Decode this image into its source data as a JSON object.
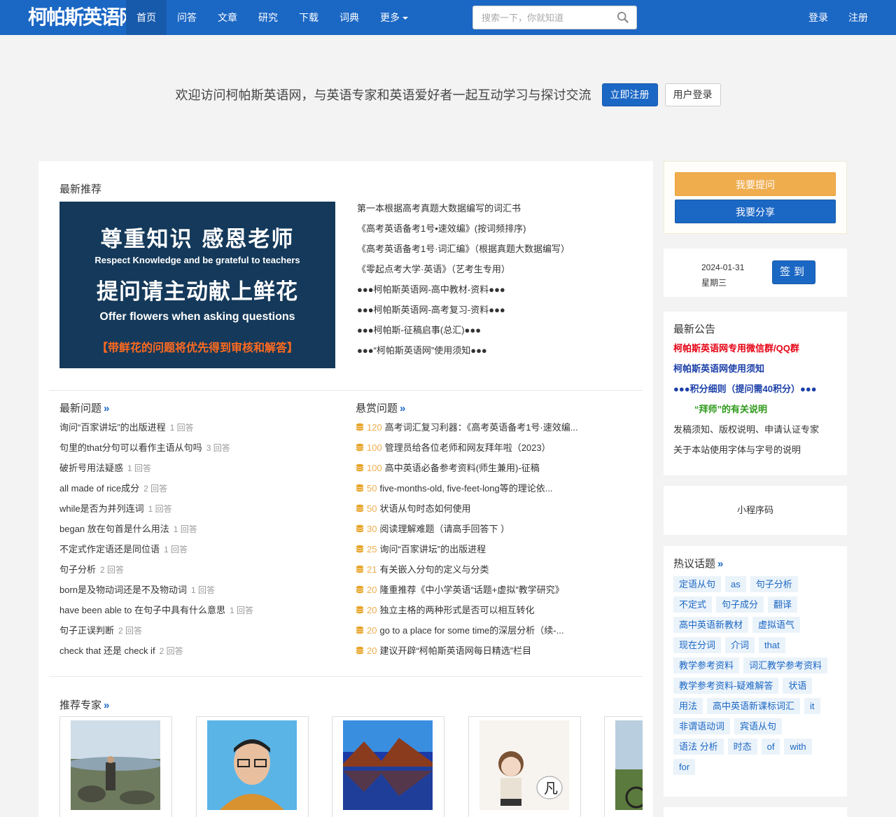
{
  "header": {
    "logo": "柯帕斯英语网",
    "nav": [
      "首页",
      "问答",
      "文章",
      "研究",
      "下载",
      "词典"
    ],
    "more": "更多",
    "search_placeholder": "搜索一下，你就知道",
    "login": "登录",
    "register": "注册"
  },
  "welcome": {
    "text": "欢迎访问柯帕斯英语网，与英语专家和英语爱好者一起互动学习与探讨交流",
    "register_btn": "立即注册",
    "login_btn": "用户登录"
  },
  "recommend": {
    "title": "最新推荐",
    "banner": {
      "line1": "尊重知识  感恩老师",
      "line2": "Respect Knowledge and be grateful to teachers",
      "line3": "提问请主动献上鲜花",
      "line4": "Offer flowers when asking questions",
      "line5": "【带鲜花的问题将优先得到审核和解答】"
    },
    "items": [
      "第一本根据高考真题大数据编写的词汇书",
      "《高考英语备考1号•速效编》(按词频排序)",
      "《高考英语备考1号·词汇编》（根据真题大数据编写）",
      "《零起点考大学·英语》（艺考生专用）",
      "●●●柯帕斯英语网-高中教材-资料●●●",
      "●●●柯帕斯英语网-高考复习-资料●●●",
      "●●●柯帕斯-征稿启事(总汇)●●●",
      "●●●“柯帕斯英语网”使用须知●●●"
    ]
  },
  "latest_questions": {
    "title": "最新问题",
    "more": "»",
    "items": [
      {
        "q": "询问“百家讲坛”的出版进程",
        "a": "1 回答"
      },
      {
        "q": "句里的that分句可以看作主语从句吗",
        "a": "3 回答"
      },
      {
        "q": "破折号用法疑惑",
        "a": "1 回答"
      },
      {
        "q": "all made of rice成分",
        "a": "2 回答"
      },
      {
        "q": "while是否为并列连词",
        "a": "1 回答"
      },
      {
        "q": "began 放在句首是什么用法",
        "a": "1 回答"
      },
      {
        "q": "不定式作定语还是同位语",
        "a": "1 回答"
      },
      {
        "q": "句子分析",
        "a": "2 回答"
      },
      {
        "q": "born是及物动词还是不及物动词",
        "a": "1 回答"
      },
      {
        "q": "have been able to 在句子中具有什么意思",
        "a": "1 回答"
      },
      {
        "q": "句子正误判断",
        "a": "2 回答"
      },
      {
        "q": "check that 还是 check if",
        "a": "2 回答"
      }
    ]
  },
  "bounty_questions": {
    "title": "悬赏问题",
    "more": "»",
    "items": [
      {
        "pts": "120",
        "q": "高考词汇复习利器：《高考英语备考1号·速效编..."
      },
      {
        "pts": "100",
        "q": "管理员给各位老师和网友拜年啦（2023）"
      },
      {
        "pts": "100",
        "q": "高中英语必备参考资料(师生兼用)-征稿"
      },
      {
        "pts": "50",
        "q": "five-months-old, five-feet-long等的理论依..."
      },
      {
        "pts": "50",
        "q": "状语从句时态如何使用"
      },
      {
        "pts": "30",
        "q": "阅读理解难题（请高手回答下 ）"
      },
      {
        "pts": "25",
        "q": "询问“百家讲坛”的出版进程"
      },
      {
        "pts": "21",
        "q": "有关嵌入分句的定义与分类"
      },
      {
        "pts": "20",
        "q": "隆重推荐《中小学英语“话题+虚拟”教学研究》"
      },
      {
        "pts": "20",
        "q": "独立主格的两种形式是否可以相互转化"
      },
      {
        "pts": "20",
        "q": "go to a place for some time的深层分析（续-..."
      },
      {
        "pts": "20",
        "q": "建议开辟“柯帕斯英语网每日精选”栏目"
      }
    ]
  },
  "experts": {
    "title": "推荐专家",
    "more": "»"
  },
  "sidebar": {
    "ask_btn": "我要提问",
    "share_btn": "我要分享",
    "date": "2024-01-31",
    "weekday": "星期三",
    "sign_btn": "签到",
    "notice_title": "最新公告",
    "notices": [
      "柯帕斯英语网专用微信群/QQ群",
      "柯帕斯英语网使用须知",
      "●●●积分细则（提问需40积分）●●●",
      "“拜师”的有关说明",
      "发稿须知、版权说明、申请认证专家",
      "关于本站使用字体与字号的说明"
    ],
    "notice_colors": [
      "#e60012",
      "#1b3fa8",
      "#1b3fa8",
      "#2e9a1a",
      "#333333",
      "#333333"
    ],
    "miniprogram": "小程序码",
    "topics_title": "热议话题",
    "topics_more": "»",
    "topics": [
      "定语从句",
      "as",
      "句子分析",
      "不定式",
      "句子成分",
      "翻译",
      "高中英语新教材",
      "虚拟语气",
      "现在分词",
      "介词",
      "that",
      "教学参考资料",
      "词汇教学参考资料",
      "教学参考资料-疑难解答",
      "状语",
      "用法",
      "高中英语新课标词汇",
      "it",
      "非谓语动词",
      "宾语从句",
      "语法 分析",
      "时态",
      "of",
      "with",
      "for"
    ]
  }
}
